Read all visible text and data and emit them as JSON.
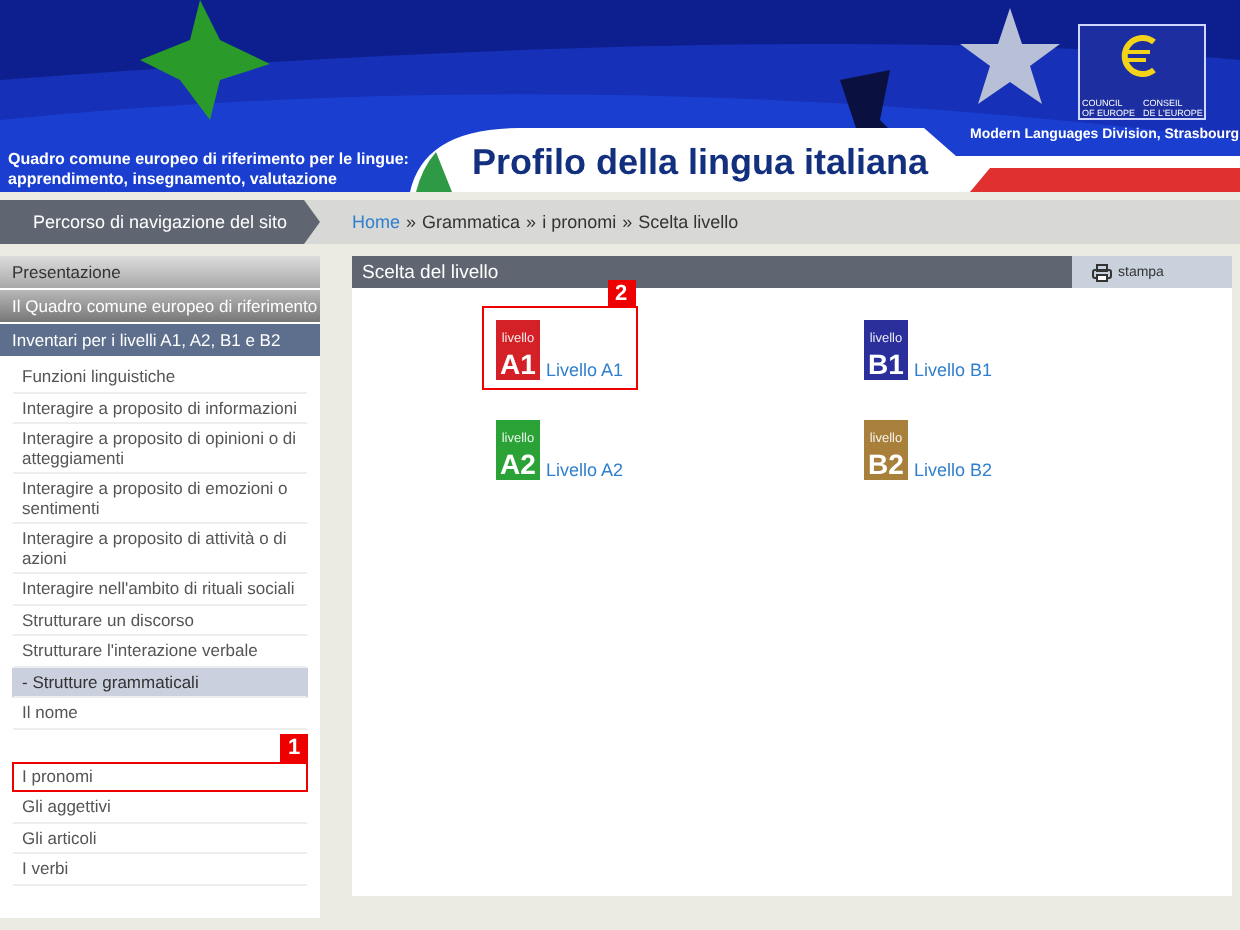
{
  "banner": {
    "subtitle_lines": [
      "Quadro comune europeo di riferimento per le lingue:",
      "apprendimento, insegnamento, valutazione"
    ],
    "title": "Profilo della lingua italiana",
    "emblem_lines": [
      "COUNCIL",
      "OF EUROPE",
      "CONSEIL",
      "DE L'EUROPE"
    ],
    "division": "Modern Languages Division, Strasbourg"
  },
  "nav_bar": {
    "label": "Percorso di navigazione del sito",
    "breadcrumb": [
      {
        "label": "Home",
        "link": true
      },
      {
        "label": "Grammatica",
        "link": false
      },
      {
        "label": "i pronomi",
        "link": false
      },
      {
        "label": "Scelta livello",
        "link": false
      }
    ],
    "separator": "»"
  },
  "sidebar": {
    "sections": [
      {
        "label": "Presentazione",
        "kind": "light"
      },
      {
        "label": "Il Quadro comune europeo di riferimento",
        "kind": "dark"
      },
      {
        "label": "Inventari per i livelli A1, A2, B1 e B2",
        "kind": "active"
      }
    ],
    "items": [
      {
        "label": "Funzioni linguistiche",
        "kind": "link",
        "selected": false
      },
      {
        "label": "Interagire a proposito di informazioni",
        "kind": "link",
        "selected": false
      },
      {
        "label": "Interagire a proposito di opinioni o di atteggiamenti",
        "kind": "link",
        "selected": false
      },
      {
        "label": "Interagire a proposito di emozioni o sentimenti",
        "kind": "link",
        "selected": false
      },
      {
        "label": "Interagire a proposito di attività o di azioni",
        "kind": "link",
        "selected": false
      },
      {
        "label": "Interagire nell'ambito di rituali sociali",
        "kind": "link",
        "selected": false
      },
      {
        "label": "Strutturare un discorso",
        "kind": "link",
        "selected": false
      },
      {
        "label": "Strutturare l'interazione verbale",
        "kind": "link",
        "selected": false
      },
      {
        "label": "- Strutture grammaticali",
        "kind": "group",
        "selected": false
      },
      {
        "label": "Il nome",
        "kind": "link",
        "selected": false
      },
      {
        "label": "I pronomi",
        "kind": "link",
        "selected": true,
        "callout": "1"
      },
      {
        "label": "Gli aggettivi",
        "kind": "link",
        "selected": false
      },
      {
        "label": "Gli articoli",
        "kind": "link",
        "selected": false
      },
      {
        "label": "I verbi",
        "kind": "link",
        "selected": false
      }
    ]
  },
  "panel": {
    "title": "Scelta del livello",
    "print": "stampa",
    "levels": [
      {
        "caption": "livello",
        "code": "A1",
        "label": "Livello A1",
        "color": "#d42128",
        "callout": "2"
      },
      {
        "caption": "livello",
        "code": "B1",
        "label": "Livello B1",
        "color": "#2a2f9c"
      },
      {
        "caption": "livello",
        "code": "A2",
        "label": "Livello A2",
        "color": "#2aa236"
      },
      {
        "caption": "livello",
        "code": "B2",
        "label": "Livello B2",
        "color": "#a8803c"
      }
    ]
  }
}
